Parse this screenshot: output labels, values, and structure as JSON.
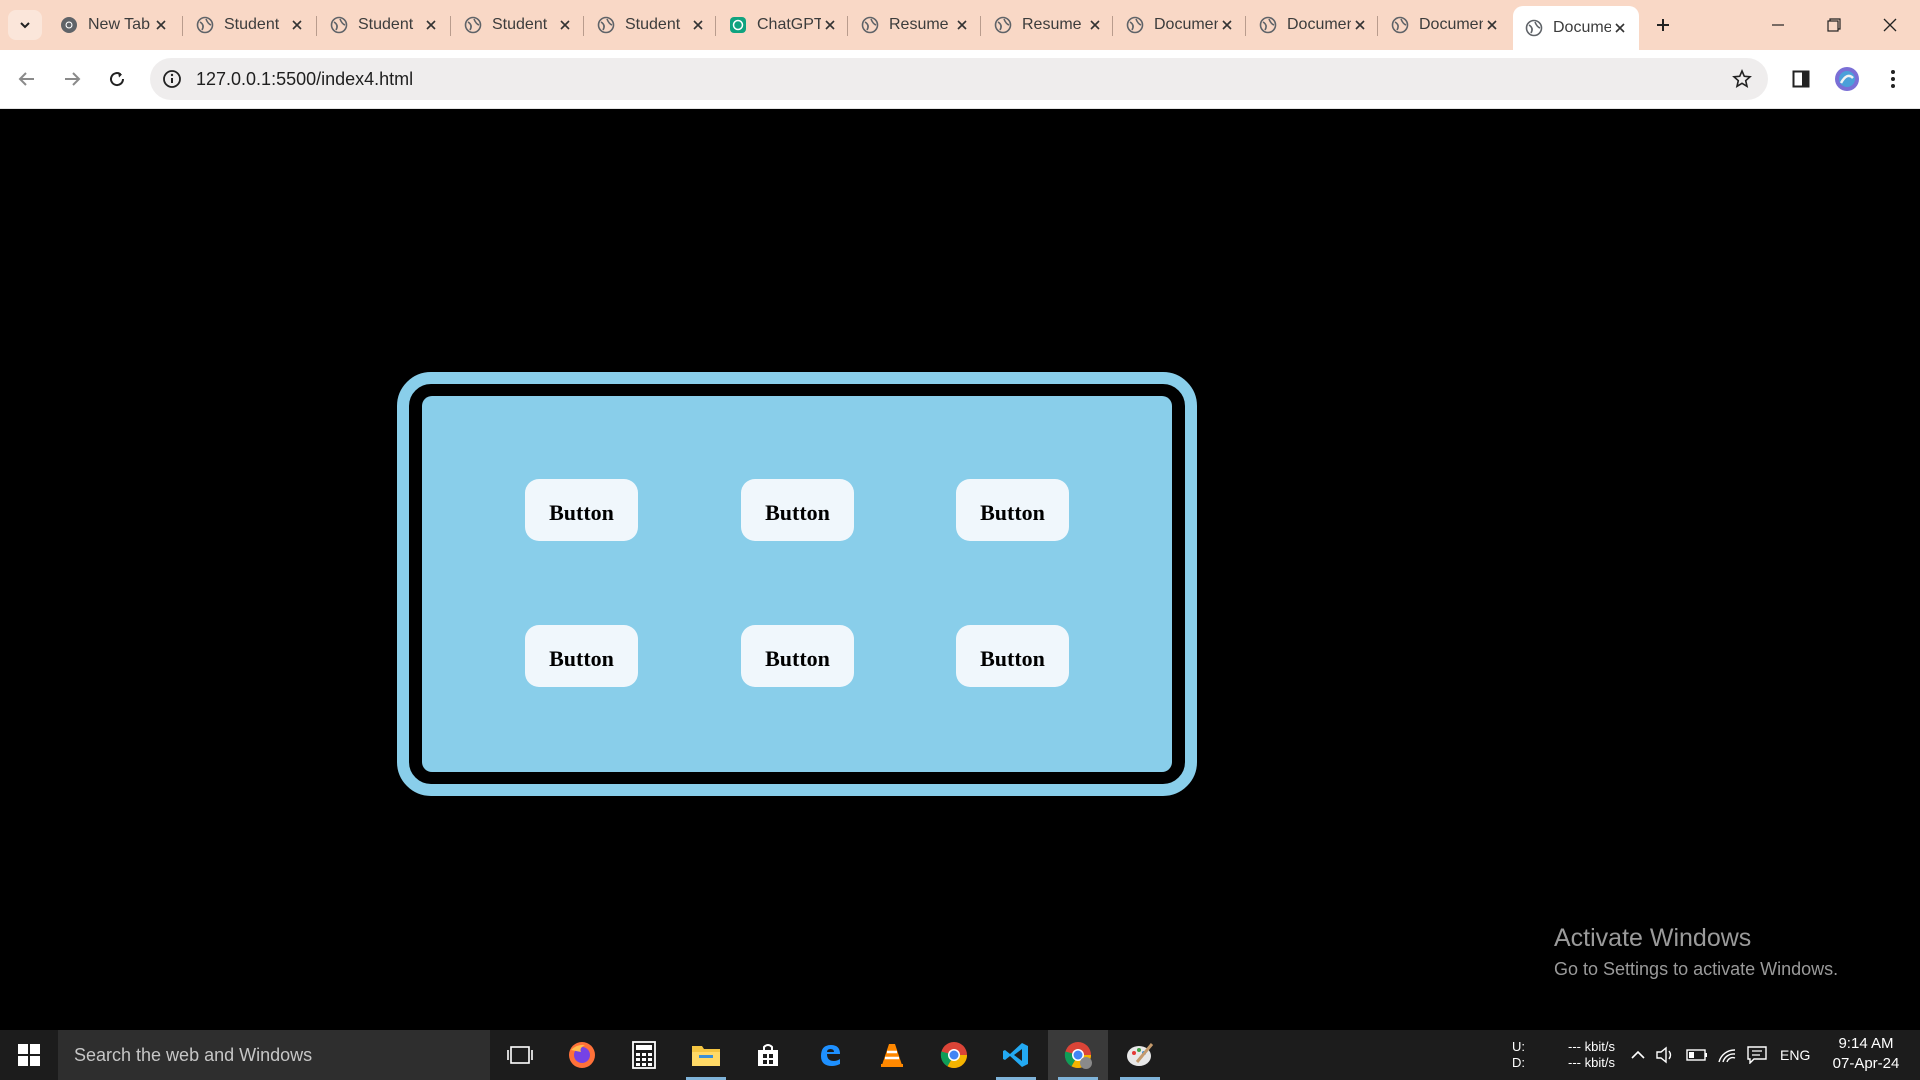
{
  "browser": {
    "tabs": [
      {
        "title": "New Tab",
        "favicon": "chrome-icon",
        "active": false
      },
      {
        "title": "Student",
        "favicon": "globe-icon",
        "active": false
      },
      {
        "title": "Student",
        "favicon": "globe-icon",
        "active": false
      },
      {
        "title": "Student",
        "favicon": "globe-icon",
        "active": false
      },
      {
        "title": "Student",
        "favicon": "globe-icon",
        "active": false
      },
      {
        "title": "ChatGPT",
        "favicon": "chatgpt-icon",
        "active": false
      },
      {
        "title": "Resume",
        "favicon": "globe-icon",
        "active": false
      },
      {
        "title": "Resume",
        "favicon": "globe-icon",
        "active": false
      },
      {
        "title": "Document",
        "favicon": "globe-icon",
        "active": false
      },
      {
        "title": "Document",
        "favicon": "globe-icon",
        "active": false
      },
      {
        "title": "Document",
        "favicon": "globe-icon",
        "active": false
      },
      {
        "title": "Document",
        "favicon": "globe-icon",
        "active": true
      }
    ],
    "url": "127.0.0.1:5500/index4.html",
    "colors": {
      "tabstrip": "#f9d8c6",
      "omnibox": "#efeded"
    }
  },
  "page": {
    "buttons": [
      {
        "label": "Button"
      },
      {
        "label": "Button"
      },
      {
        "label": "Button"
      },
      {
        "label": "Button"
      },
      {
        "label": "Button"
      },
      {
        "label": "Button"
      }
    ],
    "colors": {
      "background": "#000000",
      "panel": "#89ceea",
      "button": "#f0f7fc"
    }
  },
  "watermark": {
    "title": "Activate Windows",
    "subtitle": "Go to Settings to activate Windows."
  },
  "taskbar": {
    "search_placeholder": "Search the web and Windows",
    "apps": [
      "task-view-icon",
      "firefox-icon",
      "calculator-icon",
      "file-explorer-icon",
      "store-icon",
      "edge-icon",
      "vlc-icon",
      "chrome-icon",
      "vscode-icon",
      "chrome-dev-icon",
      "paint-icon"
    ],
    "network_up_label": "U:",
    "network_down_label": "D:",
    "network_up_value": "--- kbit/s",
    "network_down_value": "--- kbit/s",
    "language": "ENG",
    "time": "9:14 AM",
    "date": "07-Apr-24"
  }
}
